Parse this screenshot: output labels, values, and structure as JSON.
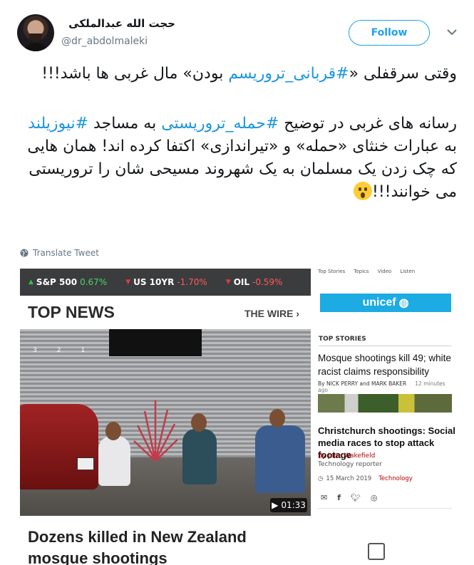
{
  "user": {
    "display_name": "حجت الله عبدالملکی",
    "handle": "@dr_abdolmaleki",
    "follow_label": "Follow"
  },
  "tweet": {
    "line1_prefix": "وقتی سرقفلی «",
    "line1_hashtag": "#قربانی_تروریسم",
    "line1_suffix": " بودن» مال غربی ها باشد!!!",
    "line2_prefix": "رسانه های غربی در توضیح ",
    "line2_hashtag1": "#حمله_تروریستی",
    "line2_mid": " به مساجد ",
    "line2_hashtag2": "#نیوزیلند",
    "line2_suffix": " به عبارات خنثای «حمله» و «تیراندازی» اکتفا کرده اند! همان هایی که چک زدن یک مسلمان به یک شهروند مسیحی شان را تروریستی می خوانند!!!",
    "translate_label": "Translate Tweet"
  },
  "left_card": {
    "tickers": [
      {
        "name": "S&P 500",
        "value": "0.67%",
        "direction": "up"
      },
      {
        "name": "US 10YR",
        "value": "-1.70%",
        "direction": "down"
      },
      {
        "name": "OIL",
        "value": "-0.59%",
        "direction": "down"
      }
    ],
    "section_title": "TOP NEWS",
    "wire_label": "THE WIRE",
    "video_duration": "01:33",
    "headline": "Dozens killed in New Zealand mosque shootings"
  },
  "right_card": {
    "nav": [
      "Top Stories",
      "Topics",
      "Video",
      "Listen"
    ],
    "brand": "unicef",
    "section": "TOP STORIES",
    "story1_headline": "Mosque shootings kill 49; white racist claims responsibility",
    "story1_byline": "By NICK PERRY and MARK BAKER",
    "story1_time": "12 minutes ago",
    "story2_headline": "Christchurch shootings: Social media races to stop attack footage",
    "story2_author": "By Jane Wakefield",
    "story2_role": "Technology reporter",
    "story2_date": "15 March 2019",
    "story2_tag": "Technology"
  },
  "colors": {
    "twitter_blue": "#1da1f2",
    "hashtag": "#1b95e0",
    "unicef": "#1cabe2",
    "bbc_red": "#b80000"
  }
}
